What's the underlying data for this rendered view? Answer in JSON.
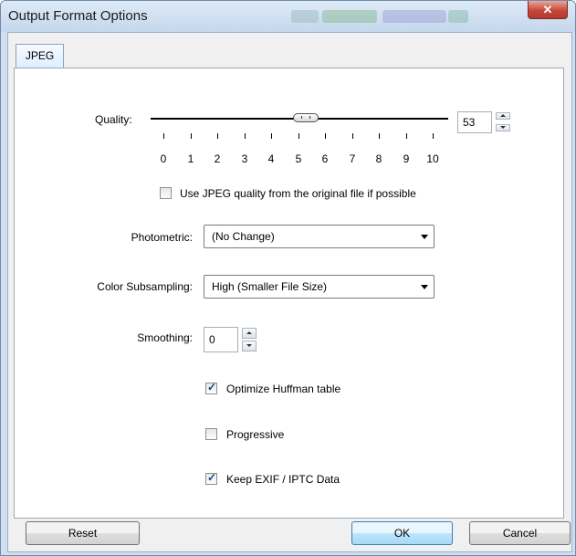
{
  "window": {
    "title": "Output Format Options"
  },
  "tabs": [
    {
      "label": "JPEG",
      "active": true
    }
  ],
  "quality": {
    "label": "Quality:",
    "value": "53",
    "slider_level": 5.3,
    "scale_labels": [
      "0",
      "1",
      "2",
      "3",
      "4",
      "5",
      "6",
      "7",
      "8",
      "9",
      "10"
    ]
  },
  "use_original_quality": {
    "label": "Use JPEG quality from the original file if possible",
    "checked": false
  },
  "photometric": {
    "label": "Photometric:",
    "selected": "(No Change)"
  },
  "color_subsampling": {
    "label": "Color Subsampling:",
    "selected": "High (Smaller File Size)"
  },
  "smoothing": {
    "label": "Smoothing:",
    "value": "0"
  },
  "options": [
    {
      "label": "Optimize Huffman table",
      "checked": true
    },
    {
      "label": "Progressive",
      "checked": false
    },
    {
      "label": "Keep EXIF / IPTC Data",
      "checked": true
    }
  ],
  "buttons": {
    "reset": "Reset",
    "ok": "OK",
    "cancel": "Cancel"
  },
  "icons": {
    "close": "close-icon"
  },
  "colors": {
    "close_button": "#c7473a",
    "default_button": "#bee6fd",
    "tab_active": "#dfeeff"
  }
}
